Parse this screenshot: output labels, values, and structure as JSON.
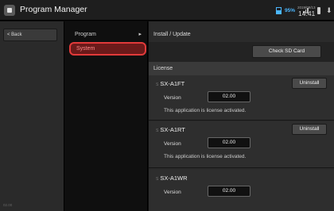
{
  "titlebar": {
    "title": "Program Manager",
    "battery": "95%",
    "date": "2019/09/13",
    "time": "14:41"
  },
  "leftbar": {
    "back_label": "< Back",
    "footer": "02.00"
  },
  "nav": {
    "items": [
      {
        "label": "Program"
      },
      {
        "label": "System"
      }
    ]
  },
  "main": {
    "install_header": "Install / Update",
    "check_sd_label": "Check SD Card",
    "license_header": "License",
    "uninstall_label": "Uninstall",
    "version_label": "Version",
    "licenses": [
      {
        "name": "SX-A1FT",
        "version": "02.00",
        "status": "This application is license activated."
      },
      {
        "name": "SX-A1RT",
        "version": "02.00",
        "status": "This application is license activated."
      },
      {
        "name": "SX-A1WR",
        "version": "02.00",
        "status": ""
      }
    ]
  }
}
